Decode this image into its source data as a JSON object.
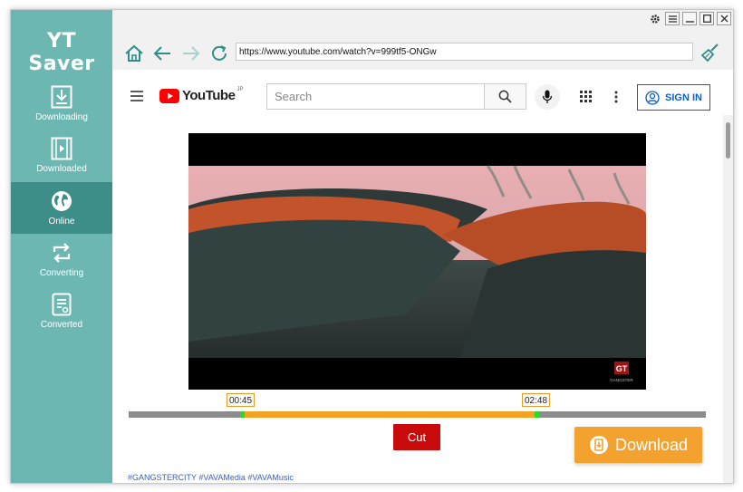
{
  "app": {
    "title": "YT Saver"
  },
  "sidebar": {
    "items": [
      {
        "label": "Downloading",
        "icon": "download-icon",
        "active": false
      },
      {
        "label": "Downloaded",
        "icon": "film-icon",
        "active": false
      },
      {
        "label": "Online",
        "icon": "globe-icon",
        "active": true
      },
      {
        "label": "Converting",
        "icon": "convert-icon",
        "active": false
      },
      {
        "label": "Converted",
        "icon": "document-icon",
        "active": false
      }
    ]
  },
  "window_controls": [
    "settings-icon",
    "menu-icon",
    "minimize-icon",
    "maximize-icon",
    "close-icon"
  ],
  "browser": {
    "url": "https://www.youtube.com/watch?v=999tf5-ONGw"
  },
  "youtube": {
    "logo_text": "YouTube",
    "region": "JP",
    "search_placeholder": "Search",
    "signin_label": "SIGN IN"
  },
  "video": {
    "watermark": "GANGSTER"
  },
  "trim": {
    "start_time": "00:45",
    "end_time": "02:48",
    "start_fraction": 0.196,
    "end_fraction": 0.708
  },
  "actions": {
    "cut_label": "Cut",
    "download_label": "Download"
  },
  "description": {
    "hashtags": "#GANGSTERCITY #VAVAMedia #VAVAMusic"
  },
  "colors": {
    "sidebar": "#6db7b2",
    "sidebar_active": "#3d8e88",
    "accent_orange": "#f4a22f",
    "cut_red": "#c90a0a",
    "youtube_red": "#ff0000",
    "link_blue": "#065fd4"
  }
}
